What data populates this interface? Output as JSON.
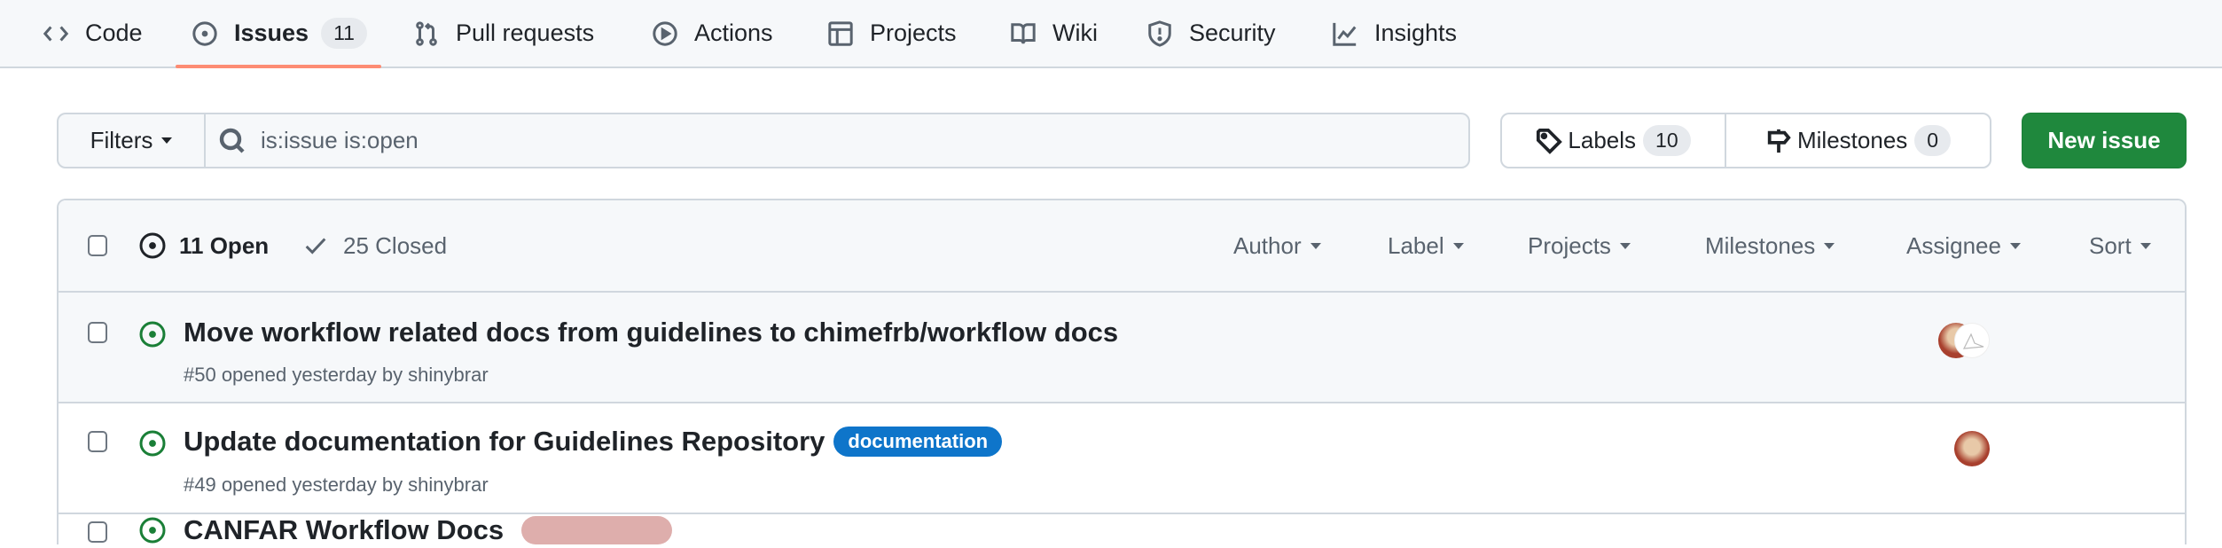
{
  "tabs": [
    {
      "label": "Code",
      "icon": "code-icon"
    },
    {
      "label": "Issues",
      "icon": "issue-opened-icon",
      "counter": "11",
      "active": true
    },
    {
      "label": "Pull requests",
      "icon": "git-pull-request-icon"
    },
    {
      "label": "Actions",
      "icon": "play-icon"
    },
    {
      "label": "Projects",
      "icon": "table-icon"
    },
    {
      "label": "Wiki",
      "icon": "book-icon"
    },
    {
      "label": "Security",
      "icon": "shield-icon"
    },
    {
      "label": "Insights",
      "icon": "graph-icon"
    }
  ],
  "filters": {
    "label": "Filters",
    "search_value": "is:issue is:open"
  },
  "labels_button": {
    "label": "Labels",
    "count": "10"
  },
  "milestones_button": {
    "label": "Milestones",
    "count": "0"
  },
  "new_issue": "New issue",
  "list_header": {
    "open": "11 Open",
    "closed": "25 Closed",
    "filters": [
      "Author",
      "Label",
      "Projects",
      "Milestones",
      "Assignee",
      "Sort"
    ]
  },
  "issues": [
    {
      "title": "Move workflow related docs from guidelines to chimefrb/workflow docs",
      "meta": "#50 opened yesterday by shinybrar",
      "labels": [],
      "assignees": 2
    },
    {
      "title": "Update documentation for Guidelines Repository",
      "meta": "#49 opened yesterday by shinybrar",
      "labels": [
        {
          "name": "documentation",
          "color": "#0e75ca",
          "text_color": "#ffffff"
        }
      ],
      "assignees": 1
    },
    {
      "title": "CANFAR Workflow Docs",
      "meta": "",
      "labels": [
        {
          "name": "",
          "color": "#deaeac",
          "text_color": "#1f2328"
        }
      ],
      "assignees": 0
    }
  ],
  "colors": {
    "accent_underline": "#fd8c73",
    "new_issue_bg": "#1f883d",
    "open_icon": "#1a7f37"
  }
}
